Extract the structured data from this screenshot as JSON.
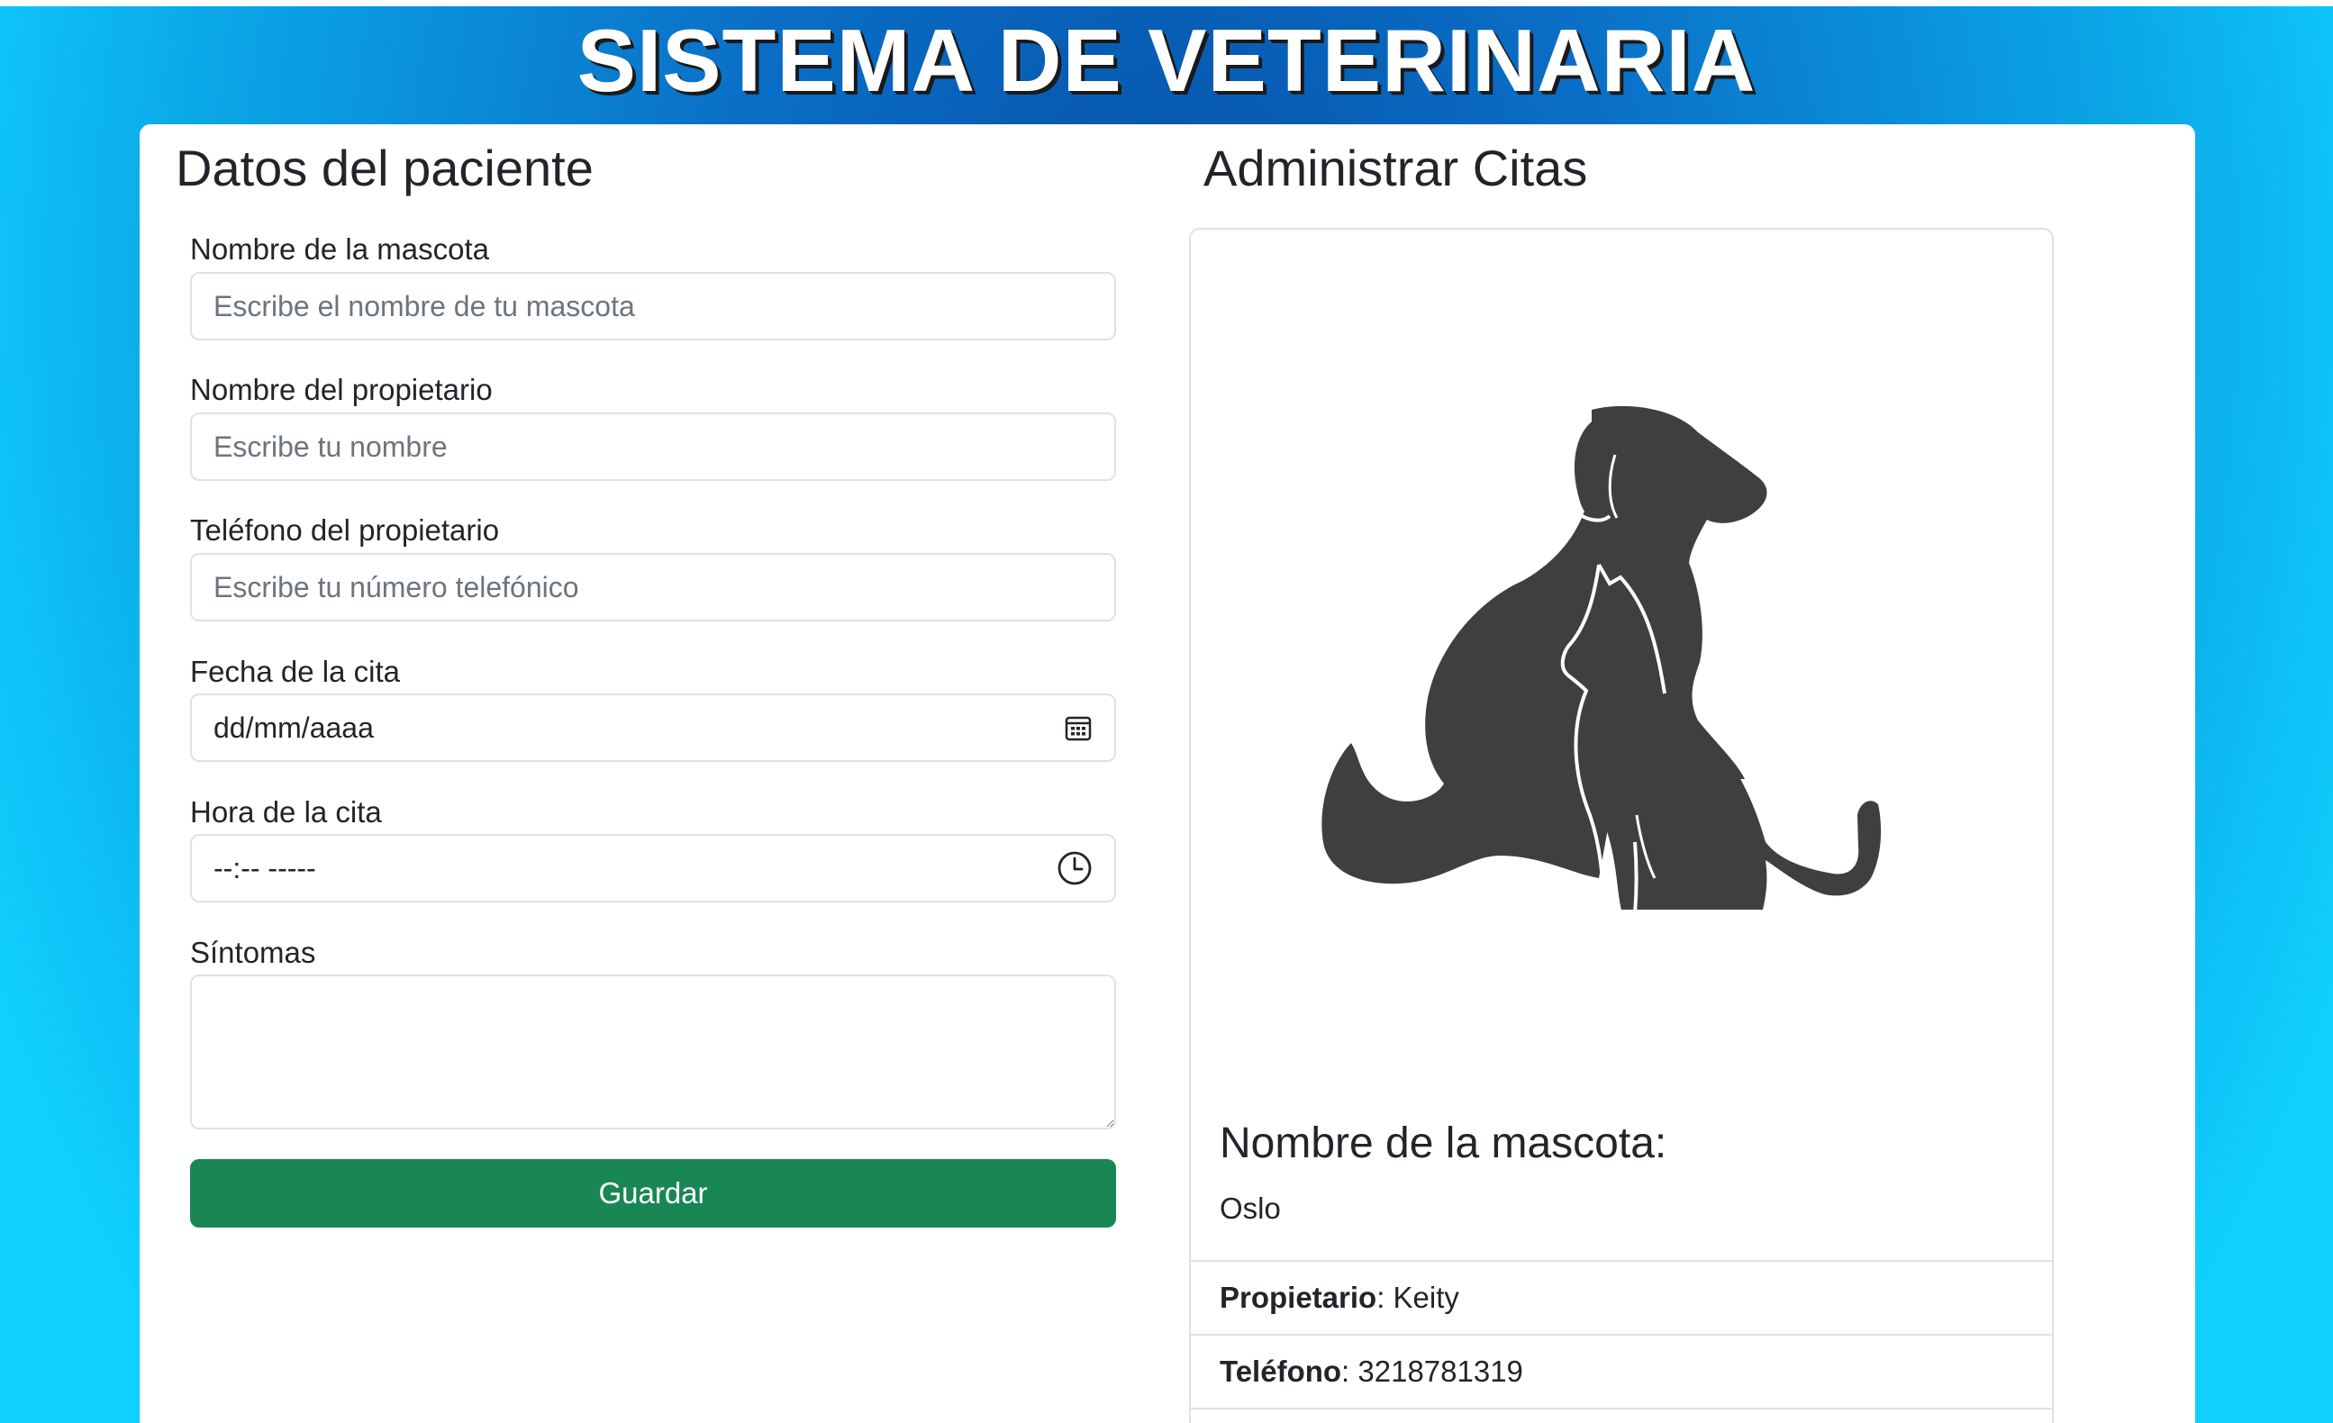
{
  "header": {
    "title": "SISTEMA DE VETERINARIA"
  },
  "patient_form": {
    "title": "Datos del paciente",
    "pet_name": {
      "label": "Nombre de la mascota",
      "placeholder": "Escribe el nombre de tu mascota"
    },
    "owner_name": {
      "label": "Nombre del propietario",
      "placeholder": "Escribe tu nombre"
    },
    "owner_phone": {
      "label": "Teléfono del propietario",
      "placeholder": "Escribe tu número telefónico"
    },
    "date": {
      "label": "Fecha de la cita",
      "value": "dd/mm/aaaa",
      "icon": "calendar-icon"
    },
    "time": {
      "label": "Hora de la cita",
      "value": "--:-- -----",
      "icon": "clock-icon"
    },
    "symptoms": {
      "label": "Síntomas",
      "value": ""
    },
    "save_label": "Guardar"
  },
  "appointments": {
    "title": "Administrar Citas",
    "image": "dog-and-cat-silhouette",
    "pet_name_title": "Nombre de la mascota:",
    "pet_name_value": "Oslo",
    "owner_label": "Propietario",
    "owner_value": ": Keity",
    "phone_label": "Teléfono",
    "phone_value": ": 3218781319"
  },
  "colors": {
    "save_button": "#198754",
    "background_dark": "#0652a8",
    "background_light": "#10d0ff",
    "silhouette": "#3f3f40"
  }
}
